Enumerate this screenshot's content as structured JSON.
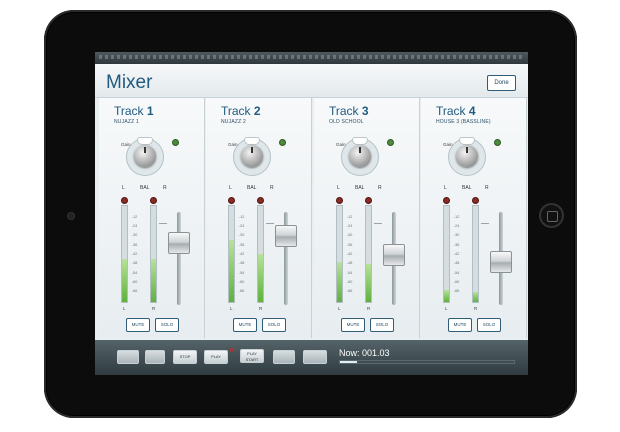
{
  "header": {
    "title": "Mixer",
    "done_label": "Done"
  },
  "tracks": [
    {
      "label": "Track",
      "number": "1",
      "name": "NUJAZZ 1",
      "gain_label": "Gain",
      "bal_left": "L",
      "bal_center": "BAL",
      "bal_right": "R",
      "meter_left": "L",
      "meter_right": "R",
      "mute": "MUTE",
      "solo": "SOLO",
      "level_left": 0.45,
      "level_right": 0.45,
      "fader": 0.72
    },
    {
      "label": "Track",
      "number": "2",
      "name": "NUJAZZ 2",
      "gain_label": "Gain",
      "bal_left": "L",
      "bal_center": "BAL",
      "bal_right": "R",
      "meter_left": "L",
      "meter_right": "R",
      "mute": "MUTE",
      "solo": "SOLO",
      "level_left": 0.65,
      "level_right": 0.5,
      "fader": 0.82
    },
    {
      "label": "Track",
      "number": "3",
      "name": "OLD SCHOOL",
      "gain_label": "Gain",
      "bal_left": "L",
      "bal_center": "BAL",
      "bal_right": "R",
      "meter_left": "L",
      "meter_right": "R",
      "mute": "MUTE",
      "solo": "SOLO",
      "level_left": 0.42,
      "level_right": 0.4,
      "fader": 0.55
    },
    {
      "label": "Track",
      "number": "4",
      "name": "HOUSE 3 (BASSLINE)",
      "gain_label": "Gain",
      "bal_left": "L",
      "bal_center": "BAL",
      "bal_right": "R",
      "meter_left": "L",
      "meter_right": "R",
      "mute": "MUTE",
      "solo": "SOLO",
      "level_left": 0.12,
      "level_right": 0.1,
      "fader": 0.45
    }
  ],
  "meter_scale": [
    "-12",
    "-24",
    "-30",
    "-36",
    "-42",
    "-48",
    "-54",
    "-60",
    "-66"
  ],
  "transport": {
    "stop": "STOP",
    "play": "PLAY",
    "play_start": "PLAY START",
    "now": "Now: 001.03",
    "progress": 0.1
  },
  "colors": {
    "accent": "#1f5a7f",
    "meter_fill": "#5fb13f",
    "led_red": "#8a2a22",
    "led_green": "#4f8a3c"
  }
}
